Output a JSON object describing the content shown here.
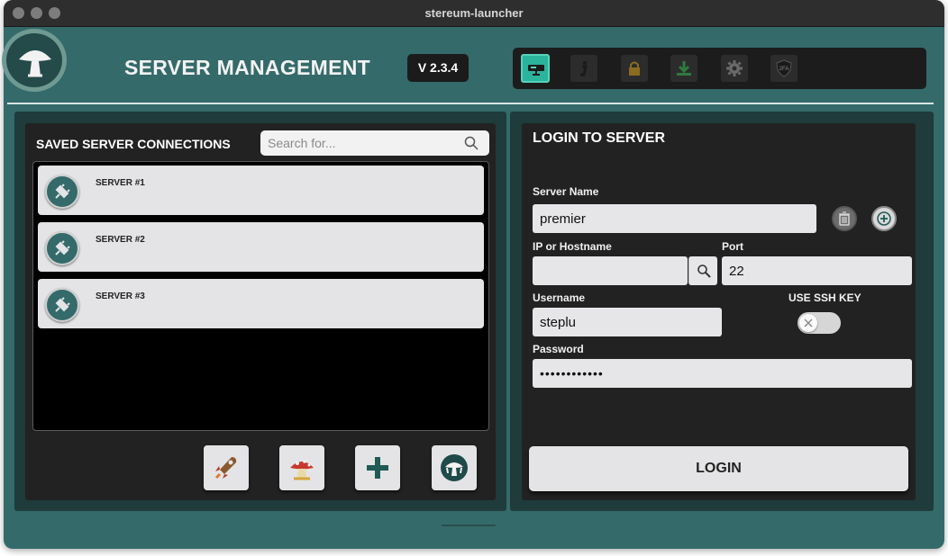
{
  "window": {
    "title": "stereum-launcher"
  },
  "header": {
    "title": "SERVER MANAGEMENT",
    "version": "V 2.3.4"
  },
  "nav": {
    "items": [
      {
        "icon": "server-icon",
        "active": true
      },
      {
        "icon": "info-icon",
        "active": false
      },
      {
        "icon": "lock-icon",
        "active": false
      },
      {
        "icon": "download-icon",
        "active": false
      },
      {
        "icon": "gear-icon",
        "active": false
      },
      {
        "icon": "shield-2fa-icon",
        "label": "2FA",
        "active": false
      }
    ]
  },
  "saved": {
    "title": "SAVED SERVER CONNECTIONS",
    "search_placeholder": "Search for...",
    "servers": [
      {
        "name": "SERVER #1"
      },
      {
        "name": "SERVER #2"
      },
      {
        "name": "SERVER #3"
      }
    ],
    "tools": [
      "rocket-icon",
      "mushroom-icon",
      "plus-icon",
      "stereum-icon"
    ]
  },
  "login": {
    "title": "LOGIN TO SERVER",
    "server_name_label": "Server Name",
    "server_name_value": "premier",
    "ip_label": "IP or Hostname",
    "ip_value": "",
    "port_label": "Port",
    "port_value": "22",
    "username_label": "Username",
    "username_value": "steplu",
    "ssh_key_label": "USE SSH KEY",
    "password_label": "Password",
    "password_value": "••••••••••••",
    "button_label": "LOGIN"
  },
  "colors": {
    "background": "#346a6a",
    "panel": "#222222",
    "accent": "#2bb39b"
  }
}
